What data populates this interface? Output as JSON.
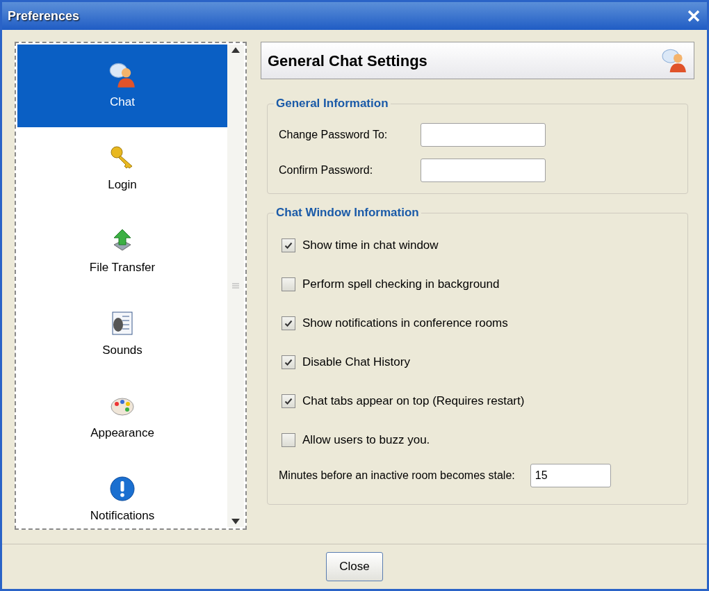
{
  "window": {
    "title": "Preferences"
  },
  "sidebar": {
    "items": [
      {
        "label": "Chat",
        "kind": "chat",
        "selected": true
      },
      {
        "label": "Login",
        "kind": "key",
        "selected": false
      },
      {
        "label": "File Transfer",
        "kind": "transfer",
        "selected": false
      },
      {
        "label": "Sounds",
        "kind": "sound",
        "selected": false
      },
      {
        "label": "Appearance",
        "kind": "palette",
        "selected": false
      },
      {
        "label": "Notifications",
        "kind": "alert",
        "selected": false
      }
    ]
  },
  "header": {
    "title": "General Chat Settings"
  },
  "general_information": {
    "title": "General Information",
    "fields": [
      {
        "label": "Change Password To:"
      },
      {
        "label": "Confirm Password:"
      }
    ]
  },
  "chat_window_information": {
    "title": "Chat Window Information",
    "options": [
      {
        "label": "Show time in chat window",
        "checked": true
      },
      {
        "label": "Perform spell checking in background",
        "checked": false
      },
      {
        "label": "Show notifications in conference rooms",
        "checked": true
      },
      {
        "label": "Disable Chat History",
        "checked": true
      },
      {
        "label": "Chat tabs appear on top (Requires restart)",
        "checked": true
      },
      {
        "label": "Allow users to buzz you.",
        "checked": false
      }
    ],
    "stale": {
      "label": "Minutes before an inactive room becomes stale:",
      "value": "15"
    }
  },
  "buttons": [
    {
      "label": "Close"
    }
  ]
}
